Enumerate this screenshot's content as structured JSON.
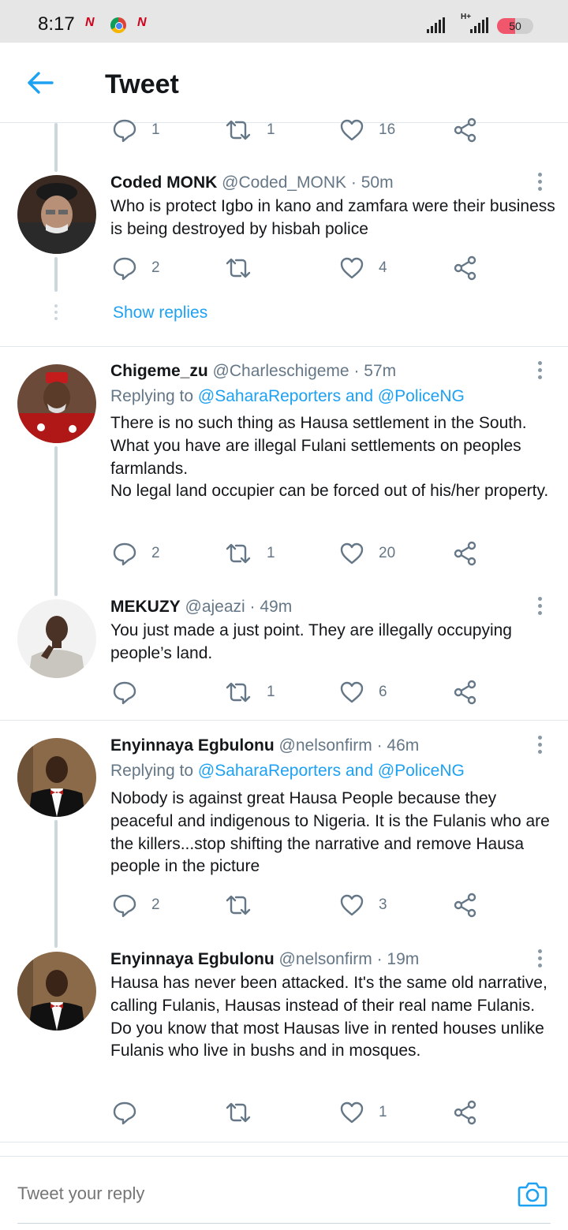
{
  "status_bar": {
    "time": "8:17",
    "battery": "50",
    "battery_level": 0.5,
    "network": "H+",
    "notification_icons": [
      "news-n-icon",
      "chrome-icon",
      "news-n-icon"
    ],
    "battery_color": "#f0566c"
  },
  "header": {
    "title": "Tweet",
    "accent_color": "#1da1f2"
  },
  "partial_tweet": {
    "actions": {
      "replies": "1",
      "retweets": "1",
      "likes": "16"
    }
  },
  "tweets": [
    {
      "name": "Coded MONK",
      "handle": "@Coded_MONK",
      "time": "· 50m",
      "body": "Who is protect Igbo in kano and zamfara were their business is being destroyed by hisbah police",
      "actions": {
        "replies": "2",
        "retweets": "",
        "likes": "4"
      }
    },
    {
      "name": "Chigeme_zu",
      "handle": "@Charleschigeme",
      "time": "· 57m",
      "replying_prefix": "Replying to",
      "replying_to": "@SaharaReporters and @PoliceNG",
      "body": "There is no such thing as Hausa settlement in the South. What you have are illegal Fulani settlements on peoples farmlands.\nNo legal land occupier can be forced out of his/her property.",
      "actions": {
        "replies": "2",
        "retweets": "1",
        "likes": "20"
      }
    },
    {
      "name": "MEKUZY",
      "handle": "@ajeazi",
      "time": "· 49m",
      "body": "You just made a just point. They are illegally occupying people’s land.",
      "actions": {
        "replies": "",
        "retweets": "1",
        "likes": "6"
      }
    },
    {
      "name": "Enyinnaya Egbulonu",
      "handle": "@nelsonfirm",
      "time": "· 46m",
      "replying_prefix": "Replying to",
      "replying_to": "@SaharaReporters and @PoliceNG",
      "body": "Nobody is against great Hausa People because they peaceful and indigenous to Nigeria. It is the Fulanis who are the killers...stop shifting the narrative and remove Hausa people in the picture",
      "actions": {
        "replies": "2",
        "retweets": "",
        "likes": "3"
      }
    },
    {
      "name": "Enyinnaya Egbulonu",
      "handle": "@nelsonfirm",
      "time": "· 19m",
      "body": "Hausa has never been attacked. It's the same old narrative, calling Fulanis, Hausas instead of their real name Fulanis. Do you know that most Hausas live in rented houses unlike Fulanis who live in bushs and in mosques.",
      "actions": {
        "replies": "",
        "retweets": "",
        "likes": "1"
      }
    }
  ],
  "show_replies": "Show replies",
  "composer": {
    "placeholder": "Tweet your reply"
  },
  "colors": {
    "link": "#1da1f2",
    "secondary_text": "#657786",
    "icon": "#657786"
  }
}
